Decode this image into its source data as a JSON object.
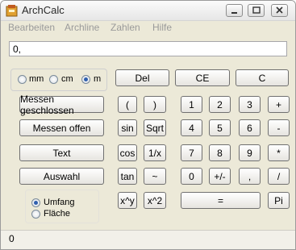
{
  "window": {
    "title": "ArchCalc"
  },
  "menu": [
    "Bearbeiten",
    "Archline",
    "Zahlen",
    "Hilfe"
  ],
  "display": {
    "value": "0,"
  },
  "units": [
    {
      "label": "mm",
      "selected": false
    },
    {
      "label": "cm",
      "selected": false
    },
    {
      "label": "m",
      "selected": true
    }
  ],
  "actions": [
    "Messen geschlossen",
    "Messen offen",
    "Text",
    "Auswahl"
  ],
  "shape_options": [
    {
      "label": "Umfang",
      "selected": true
    },
    {
      "label": "Fläche",
      "selected": false
    }
  ],
  "buttons": {
    "del": "Del",
    "ce": "CE",
    "c": "C",
    "paren_open": "(",
    "paren_close": ")",
    "sin": "sin",
    "sqrt": "Sqrt",
    "cos": "cos",
    "reciprocal": "1/x",
    "tan": "tan",
    "tilde": "~",
    "xpowy": "x^y",
    "xsq": "x^2",
    "n1": "1",
    "n2": "2",
    "n3": "3",
    "plus": "+",
    "n4": "4",
    "n5": "5",
    "n6": "6",
    "minus": "-",
    "n7": "7",
    "n8": "8",
    "n9": "9",
    "times": "*",
    "n0": "0",
    "sign": "+/-",
    "comma": ",",
    "divide": "/",
    "equals": "=",
    "pi": "Pi"
  },
  "status": {
    "value": "0"
  }
}
